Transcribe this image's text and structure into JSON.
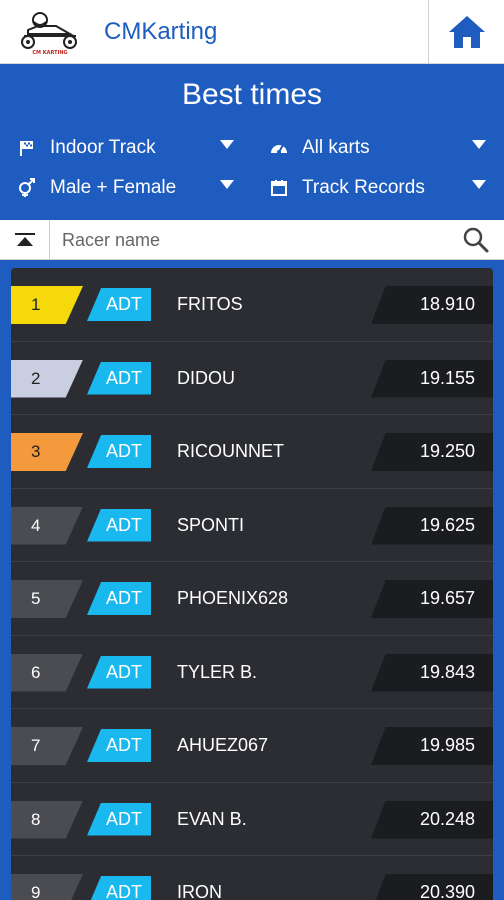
{
  "header": {
    "app_title": "CMKarting",
    "logo_text": "CM KARTING"
  },
  "panel": {
    "title": "Best times",
    "filters": {
      "track": "Indoor Track",
      "karts": "All karts",
      "gender": "Male + Female",
      "records": "Track Records"
    }
  },
  "search": {
    "placeholder": "Racer name",
    "value": ""
  },
  "rows": [
    {
      "rank": "1",
      "tag": "ADT",
      "name": "FRITOS",
      "time": "18.910",
      "rank_color": "#f5d90a",
      "rank_text": "#222222"
    },
    {
      "rank": "2",
      "tag": "ADT",
      "name": "DIDOU",
      "time": "19.155",
      "rank_color": "#c9cfe0",
      "rank_text": "#222222"
    },
    {
      "rank": "3",
      "tag": "ADT",
      "name": "RICOUNNET",
      "time": "19.250",
      "rank_color": "#f59a3c",
      "rank_text": "#222222"
    },
    {
      "rank": "4",
      "tag": "ADT",
      "name": "SPONTI",
      "time": "19.625",
      "rank_color": "#4a4c52",
      "rank_text": "#ffffff"
    },
    {
      "rank": "5",
      "tag": "ADT",
      "name": "PHOENIX628",
      "time": "19.657",
      "rank_color": "#4a4c52",
      "rank_text": "#ffffff"
    },
    {
      "rank": "6",
      "tag": "ADT",
      "name": "TYLER B.",
      "time": "19.843",
      "rank_color": "#4a4c52",
      "rank_text": "#ffffff"
    },
    {
      "rank": "7",
      "tag": "ADT",
      "name": "AHUEZ067",
      "time": "19.985",
      "rank_color": "#4a4c52",
      "rank_text": "#ffffff"
    },
    {
      "rank": "8",
      "tag": "ADT",
      "name": "EVAN B.",
      "time": "20.248",
      "rank_color": "#4a4c52",
      "rank_text": "#ffffff"
    },
    {
      "rank": "9",
      "tag": "ADT",
      "name": "IRON",
      "time": "20.390",
      "rank_color": "#4a4c52",
      "rank_text": "#ffffff"
    }
  ],
  "colors": {
    "brand_blue": "#1e5cc0",
    "tag_cyan": "#19b9ef",
    "list_bg": "#2b2d33"
  },
  "icons": {
    "home": "home-icon",
    "track": "flag-icon",
    "karts": "speedometer-icon",
    "gender": "gender-icon",
    "records": "calendar-icon",
    "collapse": "collapse-up-icon",
    "search": "search-icon"
  }
}
